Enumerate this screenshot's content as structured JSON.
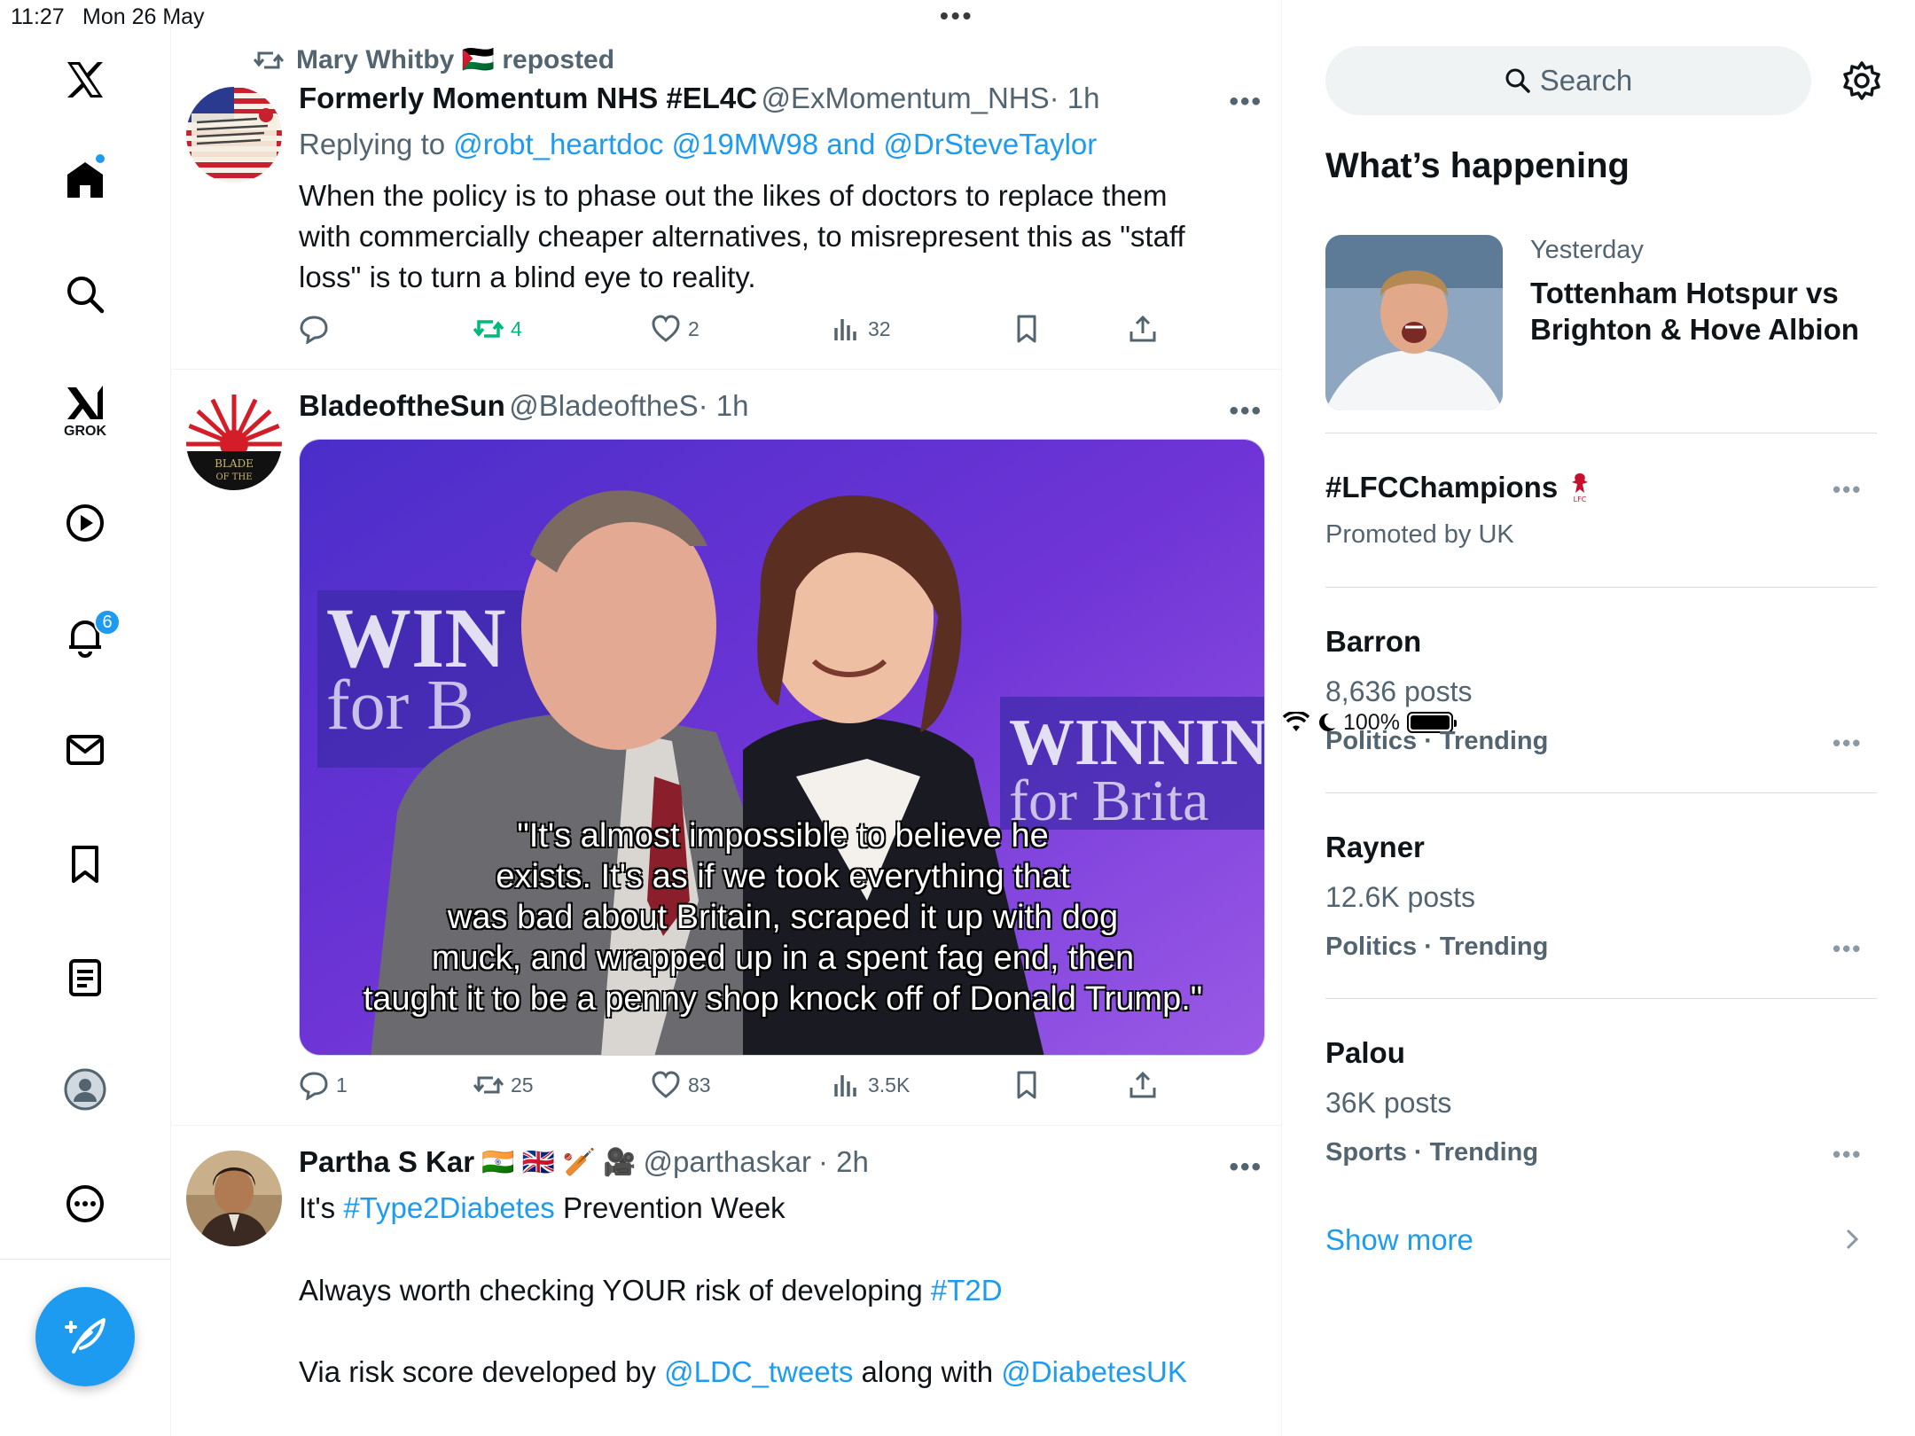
{
  "status_bar": {
    "time": "11:27",
    "date": "Mon 26 May",
    "battery": "100%"
  },
  "nav": {
    "items": [
      {
        "name": "x-logo-icon"
      },
      {
        "name": "home-icon"
      },
      {
        "name": "search-icon"
      },
      {
        "name": "grok-icon",
        "label": "GROK"
      },
      {
        "name": "video-icon"
      },
      {
        "name": "notifications-icon",
        "badge": "6"
      },
      {
        "name": "messages-icon"
      },
      {
        "name": "bookmarks-icon"
      },
      {
        "name": "lists-icon"
      },
      {
        "name": "profile-icon"
      },
      {
        "name": "more-icon"
      }
    ],
    "compose_icon": "compose-feather-icon"
  },
  "feed": {
    "tweet1": {
      "repost_label": "Mary Whitby 🇵🇸 reposted",
      "name": "Formerly Momentum NHS #EL4C",
      "handle": "@ExMomentum_NHS",
      "time": "· 1h",
      "replying_prefix": "Replying to",
      "replying_to": "@robt_heartdoc @19MW98 and @DrSteveTaylor",
      "text_line1": "When the policy is to phase out the likes of doctors to replace them",
      "text_line2": "with commercially cheaper alternatives, to misrepresent this as \"staff",
      "text_line3": "loss\" is to turn a blind eye to reality.",
      "replies": "",
      "reposts": "4",
      "likes": "2",
      "views": "32"
    },
    "tweet2": {
      "name": "BladeoftheSun",
      "handle": "@BladeoftheS",
      "time": "· 1h",
      "image_caption_line1": "\"It's almost impossible to believe he",
      "image_caption_line2": "exists. It's as if we took everything that",
      "image_caption_line3": "was bad about Britain, scraped it up with dog",
      "image_caption_line4": "muck, and wrapped up in a spent fag end, then",
      "image_caption_line5": "taught it to be a penny shop knock off of Donald Trump.\"",
      "sign_text_left": "WIN",
      "sign_text_left2": "for B",
      "sign_text_right": "WINNIN",
      "sign_text_right2": "for Brita",
      "replies": "1",
      "reposts": "25",
      "likes": "83",
      "views": "3.5K"
    },
    "tweet3": {
      "name": "Partha S Kar",
      "emojis": "🇮🇳 🇬🇧 🏏 🎥",
      "handle": "@parthaskar",
      "time": "· 2h",
      "line1_prefix": "It's ",
      "line1_tag": "#Type2Diabetes",
      "line1_suffix": " Prevention Week",
      "line2_prefix": "Always worth checking YOUR risk of developing ",
      "line2_tag": "#T2D",
      "line3_prefix": "Via risk score developed by ",
      "line3_mention1": "@LDC_tweets",
      "line3_mid": " along with ",
      "line3_mention2": "@DiabetesUK"
    }
  },
  "sidebar": {
    "search_placeholder": "Search",
    "heading": "What’s happening",
    "featured": {
      "when": "Yesterday",
      "title_line1": "Tottenham Hotspur vs",
      "title_line2": "Brighton & Hove Albion"
    },
    "promoted": {
      "title": "#LFCChampions",
      "subtitle": "Promoted by UK"
    },
    "trends": [
      {
        "title": "Barron",
        "posts": "8,636 posts",
        "category": "Politics · Trending"
      },
      {
        "title": "Rayner",
        "posts": "12.6K posts",
        "category": "Politics · Trending"
      },
      {
        "title": "Palou",
        "posts": "36K posts",
        "category": "Sports · Trending"
      }
    ],
    "show_more": "Show more"
  },
  "colors": {
    "accent": "#1d9bf0",
    "repost_green": "#00ba7c",
    "secondary_text": "#536471"
  }
}
